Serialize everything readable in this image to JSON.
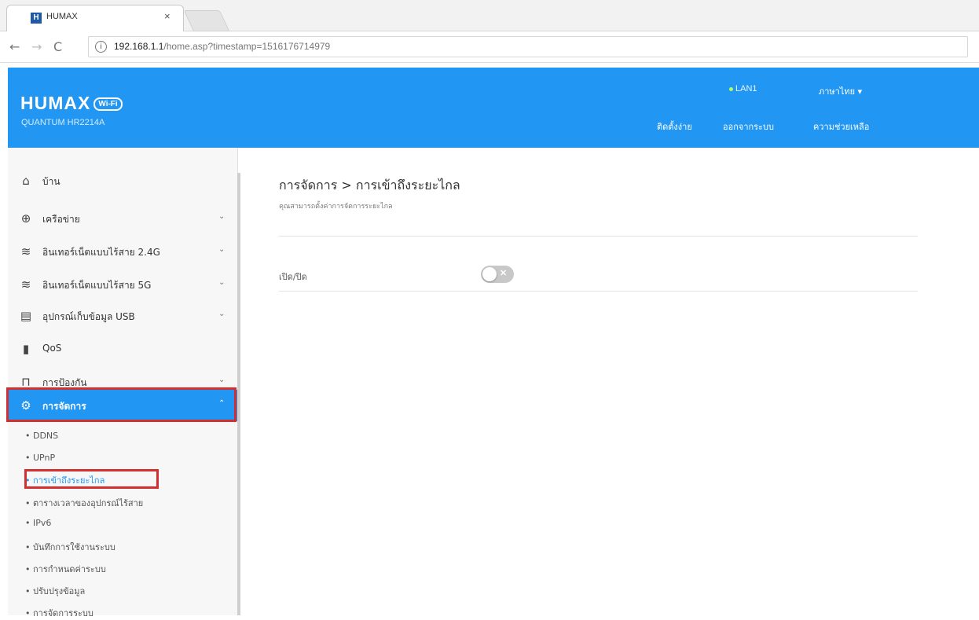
{
  "browser": {
    "tab_title": "HUMAX",
    "tab_favicon": "H",
    "tab_close": "×",
    "url_host": "192.168.1.1",
    "url_path": "/home.asp?timestamp=1516176714979",
    "back_icon": "←",
    "forward_icon": "→",
    "reload_icon": "C",
    "info_icon": "i"
  },
  "header": {
    "brand": "HUMAX",
    "brand_badge": "Wi-Fi",
    "model": "QUANTUM HR2214A",
    "lan_status": "LAN1",
    "language": "ภาษาไทย ▾",
    "links": [
      "ติดตั้งง่าย",
      "ออกจากระบบ",
      "ความช่วยเหลือ"
    ]
  },
  "sidebar": {
    "items": [
      {
        "label": "บ้าน",
        "icon": "home-icon",
        "glyph": "⌂",
        "chevron": ""
      },
      {
        "label": "เครือข่าย",
        "icon": "globe-icon",
        "glyph": "⊕",
        "chevron": "⌄"
      },
      {
        "label": "อินเทอร์เน็ตแบบไร้สาย 2.4G",
        "icon": "wifi-icon",
        "glyph": "≋",
        "chevron": "⌄"
      },
      {
        "label": "อินเทอร์เน็ตแบบไร้สาย 5G",
        "icon": "wifi-icon",
        "glyph": "≋",
        "chevron": "⌄"
      },
      {
        "label": "อุปกรณ์เก็บข้อมูล USB",
        "icon": "usb-storage-icon",
        "glyph": "▤",
        "chevron": "⌄"
      },
      {
        "label": "QoS",
        "icon": "bar-chart-icon",
        "glyph": "▮",
        "chevron": ""
      },
      {
        "label": "การป้องกัน",
        "icon": "lock-icon",
        "glyph": "⊓",
        "chevron": "⌄"
      },
      {
        "label": "การจัดการ",
        "icon": "gear-icon",
        "glyph": "⚙",
        "chevron": "⌃"
      }
    ],
    "subitems": [
      "• DDNS",
      "• UPnP",
      "• การเข้าถึงระยะไกล",
      "• ตารางเวลาของอุปกรณ์ไร้สาย",
      "• IPv6",
      "• บันทึกการใช้งานระบบ",
      "• การกำหนดค่าระบบ",
      "• ปรับปรุงข้อมูล",
      "• การจัดการระบบ"
    ]
  },
  "main": {
    "title": "การจัดการ > การเข้าถึงระยะไกล",
    "subtitle": "คุณสามารถตั้งค่าการจัดการระยะไกล",
    "setting_label": "เปิด/ปิด",
    "toggle_mark": "✕",
    "toggle_on": false
  },
  "colors": {
    "accent": "#2196f3",
    "highlight_outline": "#d32f2f"
  }
}
